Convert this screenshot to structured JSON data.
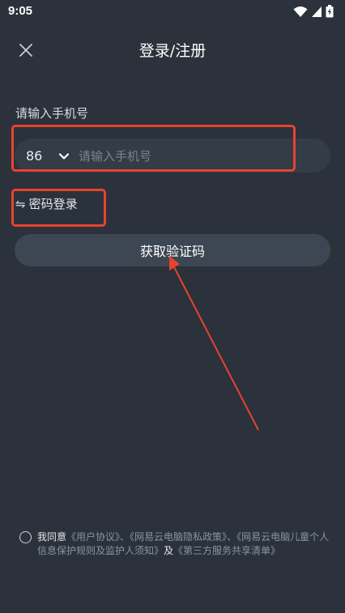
{
  "status_bar": {
    "time": "9:05",
    "icons": [
      "wifi-icon",
      "signal-icon",
      "battery-charging-icon"
    ]
  },
  "header": {
    "title": "登录/注册",
    "close_icon": "close-icon"
  },
  "phone": {
    "label": "请输入手机号",
    "country_code": "86",
    "placeholder": "请输入手机号",
    "value": ""
  },
  "password_login": {
    "icon": "⇋",
    "label": "密码登录"
  },
  "get_code_button": "获取验证码",
  "agreement": {
    "prefix": "我同意",
    "user_agreement": "《用户协议》",
    "sep1": "、",
    "privacy_policy": "《网易云电脑隐私政策》",
    "sep2": "、",
    "children_rules": "《网易云电脑儿童个人信息保护规则及监护人须知》",
    "and": "及",
    "third_party": "《第三方服务共享清单》"
  },
  "colors": {
    "background": "#2b323b",
    "annotation_red": "#e8432e",
    "button_bg": "#3d4653",
    "field_bg": "#343c46"
  }
}
